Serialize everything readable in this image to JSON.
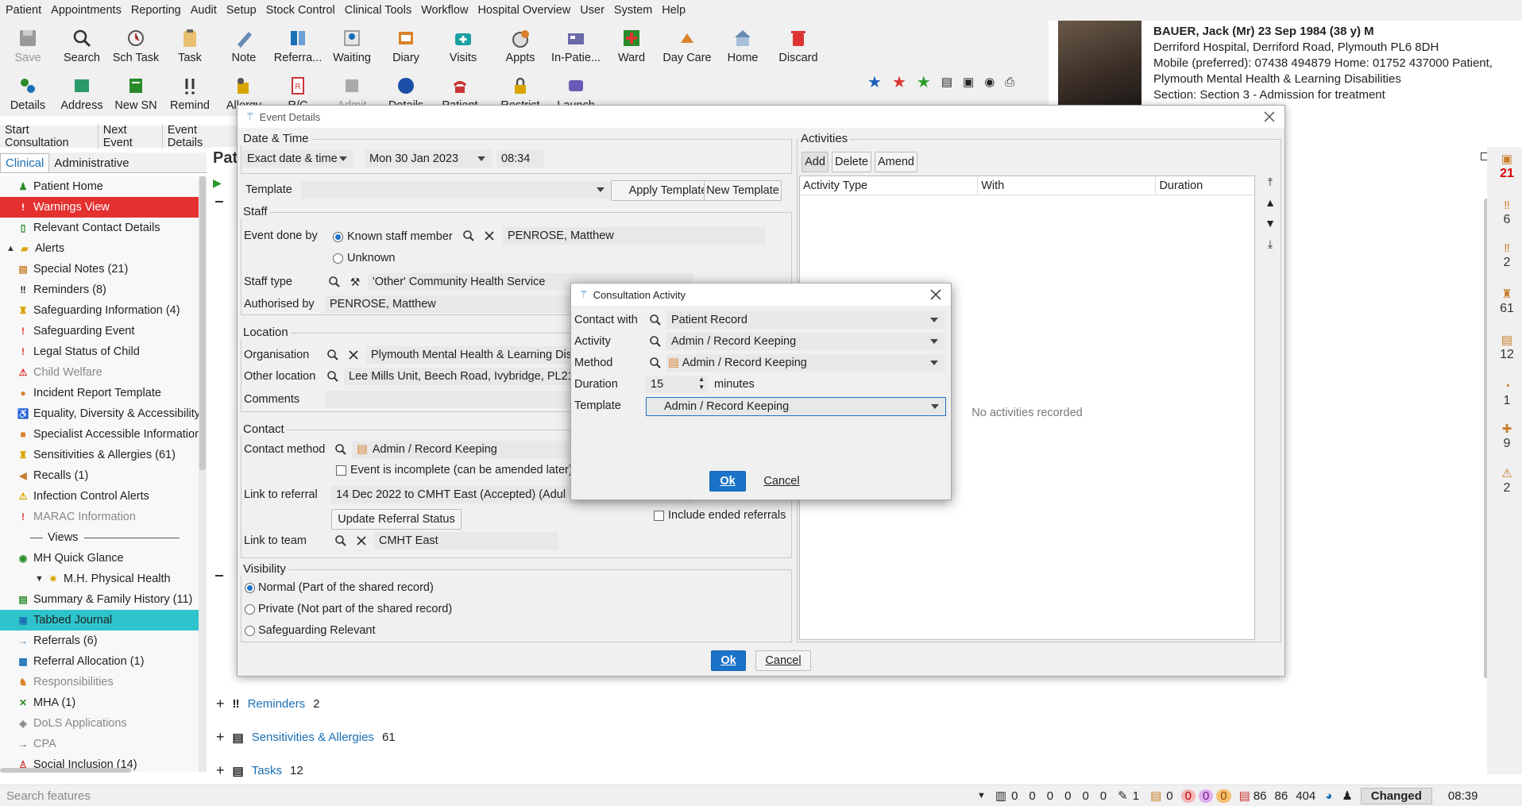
{
  "menu": [
    "Patient",
    "Appointments",
    "Reporting",
    "Audit",
    "Setup",
    "Stock Control",
    "Clinical Tools",
    "Workflow",
    "Hospital Overview",
    "User",
    "System",
    "Help"
  ],
  "toolbar_row1": [
    {
      "label": "Save",
      "icon": "floppy-icon",
      "dim": true
    },
    {
      "label": "Search",
      "icon": "magnifier-icon"
    },
    {
      "label": "Sch Task",
      "icon": "scheduled-task-icon"
    },
    {
      "label": "Task",
      "icon": "clipboard-icon"
    },
    {
      "label": "Note",
      "icon": "pen-icon"
    },
    {
      "label": "Referra...",
      "icon": "referral-icon"
    },
    {
      "label": "Waiting",
      "icon": "waiting-list-icon"
    },
    {
      "label": "Diary",
      "icon": "diary-icon"
    },
    {
      "label": "Visits",
      "icon": "medical-bag-icon"
    },
    {
      "label": "Appts",
      "icon": "appointment-clock-icon"
    },
    {
      "label": "In-Patie...",
      "icon": "in-patient-icon"
    },
    {
      "label": "Ward",
      "icon": "ward-cross-icon"
    },
    {
      "label": "Day Care",
      "icon": "day-care-icon"
    },
    {
      "label": "Home",
      "icon": "home-icon"
    },
    {
      "label": "Discard",
      "icon": "trash-icon"
    }
  ],
  "toolbar_row2": [
    {
      "label": "Details",
      "icon": "people-icon"
    },
    {
      "label": "Address",
      "icon": "address-icon"
    },
    {
      "label": "New SN",
      "icon": "new-sn-icon"
    },
    {
      "label": "Remind",
      "icon": "double-exclaim-icon"
    },
    {
      "label": "Allergy",
      "icon": "allergy-icon"
    },
    {
      "label": "R/C",
      "icon": "rc-icon"
    },
    {
      "label": "Admit",
      "icon": "admit-icon",
      "dim": true
    },
    {
      "label": "Details",
      "icon": "blue-circle-icon"
    },
    {
      "label": "Patient",
      "icon": "phone-icon"
    },
    {
      "label": "Restrict",
      "icon": "lock-icon"
    },
    {
      "label": "Launch",
      "icon": "launch-icon"
    }
  ],
  "subtabs": [
    "Start Consultation",
    "Next Event",
    "Event Details"
  ],
  "patient": {
    "name_line": "BAUER, Jack (Mr) 23 Sep 1984 (38 y) M",
    "address": "Derriford Hospital, Derriford Road, Plymouth PL6 8DH",
    "phones": "Mobile (preferred): 07438 494879 Home: 01752 437000   Patient,",
    "org": "Plymouth Mental Health & Learning Disabilities",
    "section": "Section: Section 3 - Admission for treatment"
  },
  "left_tabs": [
    "Clinical",
    "Administrative"
  ],
  "main_title": "Pat",
  "sidebar": [
    {
      "label": "Patient Home",
      "icon": "person-icon",
      "color": "#2a8a2a"
    },
    {
      "label": "Warnings View",
      "icon": "warning-icon",
      "color": "#c00",
      "highlight": "red"
    },
    {
      "label": "Relevant Contact Details",
      "icon": "contact-icon",
      "color": "#2a8a2a"
    },
    {
      "label": "Alerts",
      "icon": "folder-icon",
      "color": "#d9a400",
      "expand": "^"
    },
    {
      "label": "Special Notes (21)",
      "icon": "notes-icon",
      "color": "#c87d2c"
    },
    {
      "label": "Reminders (8)",
      "icon": "double-exclaim-icon",
      "color": "#222"
    },
    {
      "label": "Safeguarding Information (4)",
      "icon": "safeguard-icon",
      "color": "#d9a400"
    },
    {
      "label": "Safeguarding Event",
      "icon": "alert-circle-icon",
      "color": "#d33"
    },
    {
      "label": "Legal Status of Child",
      "icon": "alert-circle-icon",
      "color": "#d33"
    },
    {
      "label": "Child Welfare",
      "icon": "triangle-icon",
      "color": "#d33",
      "dim": true
    },
    {
      "label": "Incident Report Template",
      "icon": "circle-icon",
      "color": "#d9822b"
    },
    {
      "label": "Equality, Diversity & Accessibility",
      "icon": "wheelchair-icon",
      "color": "#2a8a2a"
    },
    {
      "label": "Specialist Accessible Information",
      "icon": "square-icon",
      "color": "#d9822b"
    },
    {
      "label": "Sensitivities & Allergies (61)",
      "icon": "allergy-icon",
      "color": "#d9a400"
    },
    {
      "label": "Recalls (1)",
      "icon": "recall-icon",
      "color": "#c87d2c"
    },
    {
      "label": "Infection Control Alerts",
      "icon": "warning-triangle-icon",
      "color": "#d9a400"
    },
    {
      "label": "MARAC Information",
      "icon": "alert-circle-icon",
      "color": "#d33",
      "dim": true
    },
    {
      "label": "Views",
      "icon": "",
      "color": "#222",
      "divider": true
    },
    {
      "label": "MH Quick Glance",
      "icon": "eye-icon",
      "color": "#2a8a2a"
    },
    {
      "label": "M.H. Physical Health",
      "icon": "star-icon",
      "color": "#d9a400",
      "expand": "v"
    },
    {
      "label": "Summary & Family History (11)",
      "icon": "summary-icon",
      "color": "#2a8a2a"
    },
    {
      "label": "Tabbed Journal",
      "icon": "journal-icon",
      "color": "#1a6fb5",
      "highlight": "teal"
    },
    {
      "label": "Referrals (6)",
      "icon": "arrow-icon",
      "color": "#1a6fb5"
    },
    {
      "label": "Referral Allocation (1)",
      "icon": "table-icon",
      "color": "#1a6fb5"
    },
    {
      "label": "Responsibilities",
      "icon": "people-icon",
      "color": "#d9822b",
      "dim": true
    },
    {
      "label": "MHA (1)",
      "icon": "cross-icon",
      "color": "#2a8a2a"
    },
    {
      "label": "DoLS Applications",
      "icon": "dols-icon",
      "color": "#888",
      "dim": true
    },
    {
      "label": "CPA",
      "icon": "arrow-icon",
      "color": "#444",
      "dim": true
    },
    {
      "label": "Social Inclusion (14)",
      "icon": "social-icon",
      "color": "#c33"
    }
  ],
  "main_rows": [
    {
      "label": "Reminders",
      "count": "2"
    },
    {
      "label": "Sensitivities & Allergies",
      "count": "61"
    },
    {
      "label": "Tasks",
      "count": "12"
    }
  ],
  "right_strip": [
    {
      "icon": "badge-icon",
      "value": "21",
      "color": "#d00"
    },
    {
      "icon": "double-exclaim-icon",
      "value": "6",
      "color": "#333"
    },
    {
      "icon": "double-exclaim-icon",
      "value": "2",
      "color": "#333"
    },
    {
      "icon": "allergy-icon",
      "value": "61",
      "color": "#333"
    },
    {
      "icon": "clipboard-icon",
      "value": "12",
      "color": "#333"
    },
    {
      "icon": "recall-icon",
      "value": "1",
      "color": "#333"
    },
    {
      "icon": "medical-bag-icon",
      "value": "9",
      "color": "#333"
    },
    {
      "icon": "warning-triangle-icon",
      "value": "2",
      "color": "#333"
    }
  ],
  "status": {
    "search_placeholder": "Search features",
    "counts": [
      "0",
      "0",
      "0",
      "0",
      "0",
      "0"
    ],
    "rest1": "1",
    "rest2": "0",
    "rest3": "0",
    "circle_a": "0",
    "circle_b": "0",
    "circle_c": "0",
    "nums": [
      "86",
      "86",
      "404"
    ],
    "changed": "Changed",
    "time": "08:39"
  },
  "event_dialog": {
    "title": "Event Details",
    "datetime_legend": "Date & Time",
    "date_mode": "Exact date & time",
    "date": "Mon 30 Jan 2023",
    "time": "08:34",
    "template_label": "Template",
    "template_value": "",
    "apply_template": "Apply Template",
    "new_template": "New Template",
    "staff_legend": "Staff",
    "event_done_by": "Event done by",
    "known_staff": "Known staff member",
    "unknown": "Unknown",
    "staff_member": "PENROSE, Matthew",
    "staff_type_label": "Staff type",
    "staff_type": "'Other' Community Health Service",
    "authorised_by_label": "Authorised by",
    "authorised_by": "PENROSE, Matthew",
    "location_legend": "Location",
    "organisation_label": "Organisation",
    "organisation": "Plymouth Mental Health & Learning Disa",
    "other_location_label": "Other location",
    "other_location": "Lee Mills Unit, Beech Road, Ivybridge, PL21",
    "comments_label": "Comments",
    "contact_legend": "Contact",
    "contact_method_label": "Contact method",
    "contact_method": "Admin / Record Keeping",
    "incomplete": "Event is incomplete (can be amended later)",
    "link_referral_label": "Link to referral",
    "link_referral": "14 Dec 2022 to CMHT East (Accepted)  (Adul",
    "update_referral": "Update Referral Status",
    "include_ended": "Include ended referrals",
    "link_team_label": "Link to team",
    "link_team": "CMHT East",
    "visibility_legend": "Visibility",
    "vis_normal": "Normal (Part of the shared record)",
    "vis_private": "Private (Not part of the shared record)",
    "vis_safeguarding": "Safeguarding Relevant",
    "activities_legend": "Activities",
    "add": "Add",
    "delete": "Delete",
    "amend": "Amend",
    "col_type": "Activity Type",
    "col_with": "With",
    "col_duration": "Duration",
    "empty": "No activities recorded",
    "ok": "Ok",
    "cancel": "Cancel"
  },
  "activity_dialog": {
    "title": "Consultation Activity",
    "contact_with_label": "Contact with",
    "contact_with": "Patient Record",
    "activity_label": "Activity",
    "activity": "Admin / Record Keeping",
    "method_label": "Method",
    "method": "Admin / Record Keeping",
    "duration_label": "Duration",
    "duration": "15",
    "minutes": "minutes",
    "template_label": "Template",
    "template": "Admin / Record Keeping",
    "ok": "Ok",
    "cancel": "Cancel"
  }
}
